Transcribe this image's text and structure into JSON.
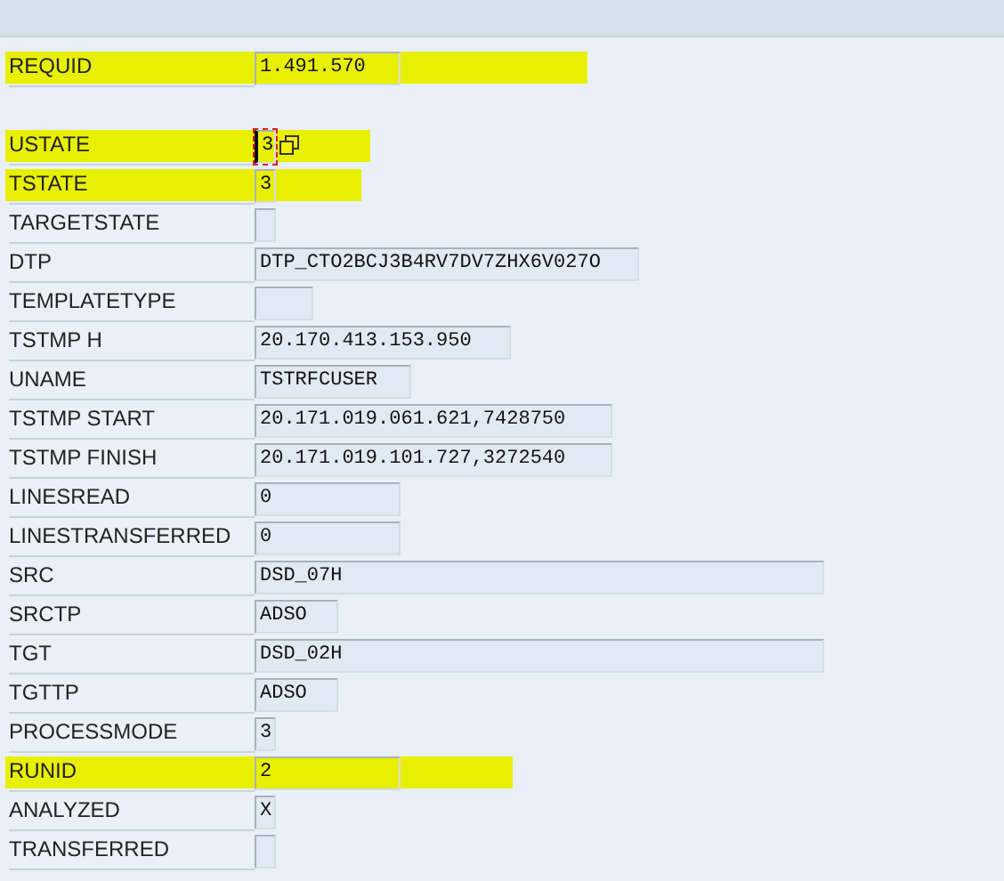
{
  "sections": [
    {
      "fields": [
        {
          "label": "REQUID",
          "value": "1.491.570",
          "highlighted": true,
          "focused": false
        }
      ]
    },
    {
      "fields": [
        {
          "label": "USTATE",
          "value": "3",
          "highlighted": true,
          "focused": true
        },
        {
          "label": "TSTATE",
          "value": "3",
          "highlighted": true,
          "focused": false
        },
        {
          "label": "TARGETSTATE",
          "highlighted": false,
          "focused": false
        },
        {
          "label": "DTP",
          "value": "DTP_CTO2BCJ3B4RV7DV7ZHX6V027O",
          "highlighted": false,
          "focused": false
        },
        {
          "label": "TEMPLATETYPE",
          "highlighted": false,
          "focused": false
        },
        {
          "label": "TSTMP H",
          "value": "20.170.413.153.950",
          "highlighted": false,
          "focused": false
        },
        {
          "label": "UNAME",
          "value": "TSTRFCUSER",
          "highlighted": false,
          "focused": false
        },
        {
          "label": "TSTMP START",
          "value": "20.171.019.061.621,7428750",
          "highlighted": false,
          "focused": false
        },
        {
          "label": "TSTMP FINISH",
          "value": "20.171.019.101.727,3272540",
          "highlighted": false,
          "focused": false
        },
        {
          "label": "LINESREAD",
          "value": "0",
          "highlighted": false,
          "focused": false
        },
        {
          "label": "LINESTRANSFERRED",
          "value": "0",
          "highlighted": false,
          "focused": false
        },
        {
          "label": "SRC",
          "value": "DSD_07H",
          "highlighted": false,
          "focused": false
        },
        {
          "label": "SRCTP",
          "value": "ADSO",
          "highlighted": false,
          "focused": false
        },
        {
          "label": "TGT",
          "value": "DSD_02H",
          "highlighted": false,
          "focused": false
        },
        {
          "label": "TGTTP",
          "value": "ADSO",
          "highlighted": false,
          "focused": false
        },
        {
          "label": "PROCESSMODE",
          "value": "3",
          "highlighted": false,
          "focused": false
        },
        {
          "label": "RUNID",
          "value": "2",
          "highlighted": true,
          "focused": false
        },
        {
          "label": "ANALYZED",
          "value": "X",
          "highlighted": false,
          "focused": false
        },
        {
          "label": "TRANSFERRED",
          "highlighted": false,
          "focused": false
        }
      ]
    }
  ]
}
